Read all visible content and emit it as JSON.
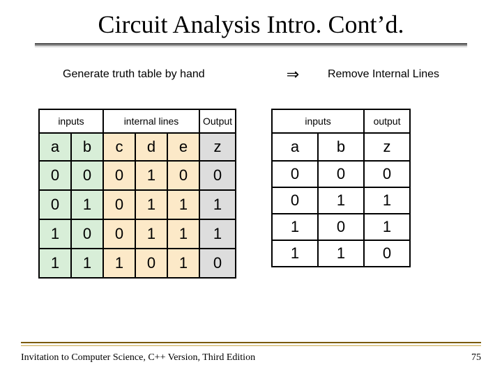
{
  "title": "Circuit Analysis Intro. Cont’d.",
  "captionLeft": "Generate truth table by hand",
  "arrow": "⇒",
  "captionRight": "Remove Internal Lines",
  "leftTable": {
    "groupHeaders": [
      "inputs",
      "internal lines",
      "Output"
    ],
    "colHeaders": [
      "a",
      "b",
      "c",
      "d",
      "e",
      "z"
    ],
    "rows": [
      [
        "0",
        "0",
        "0",
        "1",
        "0",
        "0"
      ],
      [
        "0",
        "1",
        "0",
        "1",
        "1",
        "1"
      ],
      [
        "1",
        "0",
        "0",
        "1",
        "1",
        "1"
      ],
      [
        "1",
        "1",
        "1",
        "0",
        "1",
        "0"
      ]
    ]
  },
  "rightTable": {
    "groupHeaders": [
      "inputs",
      "output"
    ],
    "colHeaders": [
      "a",
      "b",
      "z"
    ],
    "rows": [
      [
        "0",
        "0",
        "0"
      ],
      [
        "0",
        "1",
        "1"
      ],
      [
        "1",
        "0",
        "1"
      ],
      [
        "1",
        "1",
        "0"
      ]
    ]
  },
  "footer": {
    "left": "Invitation to Computer Science, C++ Version, Third Edition",
    "right": "75"
  },
  "chart_data": [
    {
      "type": "table",
      "title": "Truth table with internal lines",
      "columns": [
        "a",
        "b",
        "c",
        "d",
        "e",
        "z"
      ],
      "column_groups": {
        "inputs": [
          "a",
          "b"
        ],
        "internal lines": [
          "c",
          "d",
          "e"
        ],
        "Output": [
          "z"
        ]
      },
      "rows": [
        [
          0,
          0,
          0,
          1,
          0,
          0
        ],
        [
          0,
          1,
          0,
          1,
          1,
          1
        ],
        [
          1,
          0,
          0,
          1,
          1,
          1
        ],
        [
          1,
          1,
          1,
          0,
          1,
          0
        ]
      ]
    },
    {
      "type": "table",
      "title": "Truth table without internal lines",
      "columns": [
        "a",
        "b",
        "z"
      ],
      "column_groups": {
        "inputs": [
          "a",
          "b"
        ],
        "output": [
          "z"
        ]
      },
      "rows": [
        [
          0,
          0,
          0
        ],
        [
          0,
          1,
          1
        ],
        [
          1,
          0,
          1
        ],
        [
          1,
          1,
          0
        ]
      ]
    }
  ]
}
